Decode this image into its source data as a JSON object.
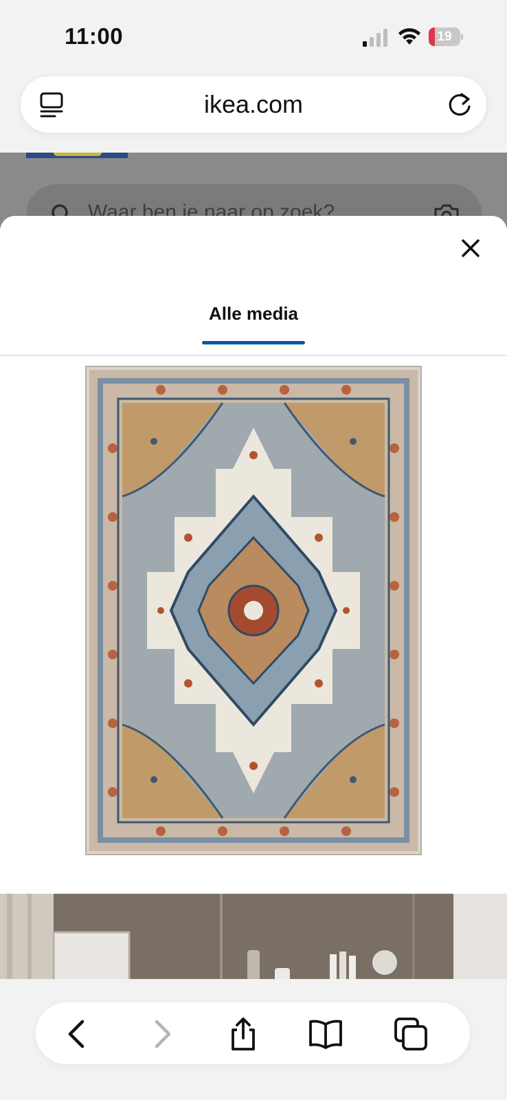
{
  "status_bar": {
    "time": "11:00",
    "battery_level": "19",
    "battery_fraction": 0.19,
    "signal_bars_active": 1
  },
  "browser": {
    "url": "ikea.com"
  },
  "page_behind": {
    "search_placeholder": "Waar ben je naar op zoek?"
  },
  "media_sheet": {
    "tab_label": "Alle media"
  },
  "colors": {
    "accent_blue": "#0058a3",
    "battery_red": "#e2344a"
  },
  "icons": {
    "url_menu": "reader-menu-icon",
    "reload": "reload-icon",
    "close": "close-icon",
    "back": "chevron-left-icon",
    "forward": "chevron-right-icon",
    "share": "share-icon",
    "bookmarks": "book-icon",
    "tabs": "tabs-icon"
  }
}
